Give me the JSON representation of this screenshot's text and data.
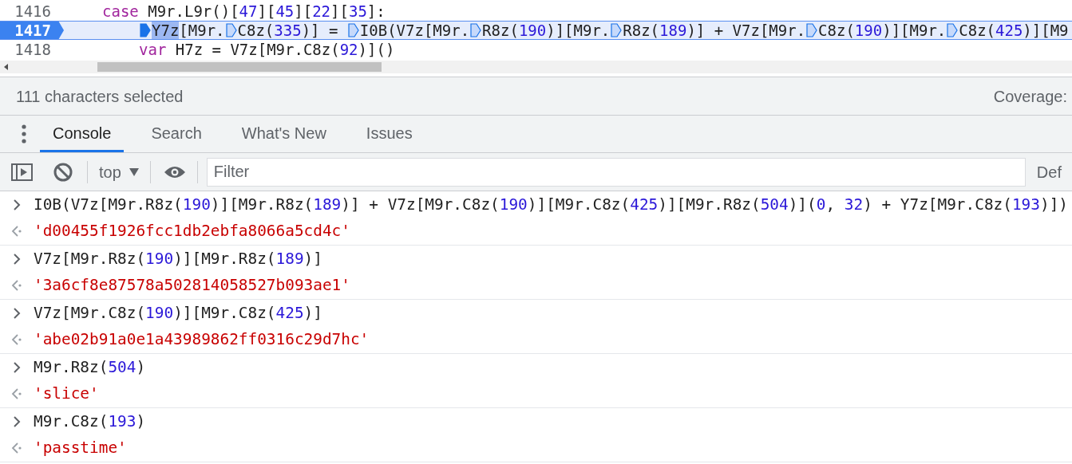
{
  "editor": {
    "lines": [
      {
        "number": "1416",
        "breakpoint": false,
        "paused": false,
        "tokens": [
          {
            "kind": "keyword",
            "text": "case"
          },
          {
            "kind": "plain",
            "text": " M9r.L9r()["
          },
          {
            "kind": "number",
            "text": "47"
          },
          {
            "kind": "plain",
            "text": "]["
          },
          {
            "kind": "number",
            "text": "45"
          },
          {
            "kind": "plain",
            "text": "]["
          },
          {
            "kind": "number",
            "text": "22"
          },
          {
            "kind": "plain",
            "text": "]["
          },
          {
            "kind": "number",
            "text": "35"
          },
          {
            "kind": "plain",
            "text": "]:"
          }
        ],
        "children": [
          {
            "number": "1417",
            "breakpoint": true,
            "paused": true,
            "tokens": [
              {
                "kind": "breakpoint",
                "active": true
              },
              {
                "kind": "selected",
                "text": "Y7z"
              },
              {
                "kind": "plain",
                "text": "[M9r."
              },
              {
                "kind": "breakpoint",
                "active": false
              },
              {
                "kind": "plain",
                "text": "C8z("
              },
              {
                "kind": "number",
                "text": "335"
              },
              {
                "kind": "plain",
                "text": ")] = "
              },
              {
                "kind": "breakpoint",
                "active": false
              },
              {
                "kind": "plain",
                "text": "I0B(V7z[M9r."
              },
              {
                "kind": "breakpoint",
                "active": false
              },
              {
                "kind": "plain",
                "text": "R8z("
              },
              {
                "kind": "number",
                "text": "190"
              },
              {
                "kind": "plain",
                "text": ")][M9r."
              },
              {
                "kind": "breakpoint",
                "active": false
              },
              {
                "kind": "plain",
                "text": "R8z("
              },
              {
                "kind": "number",
                "text": "189"
              },
              {
                "kind": "plain",
                "text": ")] + V7z[M9r."
              },
              {
                "kind": "breakpoint",
                "active": false
              },
              {
                "kind": "plain",
                "text": "C8z("
              },
              {
                "kind": "number",
                "text": "190"
              },
              {
                "kind": "plain",
                "text": ")][M9r."
              },
              {
                "kind": "breakpoint",
                "active": false
              },
              {
                "kind": "plain",
                "text": "C8z("
              },
              {
                "kind": "number",
                "text": "425"
              },
              {
                "kind": "plain",
                "text": ")][M9"
              }
            ]
          },
          {
            "number": "1418",
            "breakpoint": false,
            "paused": false,
            "tokens": [
              {
                "kind": "keyword",
                "text": "var"
              },
              {
                "kind": "plain",
                "text": " H7z = V7z[M9r.C8z("
              },
              {
                "kind": "number",
                "text": "92"
              },
              {
                "kind": "plain",
                "text": ")]()"
              }
            ]
          }
        ]
      }
    ]
  },
  "status_bar": {
    "selection": "111 characters selected",
    "coverage": "Coverage:"
  },
  "drawer_tabs": [
    {
      "label": "Console",
      "selected": true
    },
    {
      "label": "Search",
      "selected": false
    },
    {
      "label": "What's New",
      "selected": false
    },
    {
      "label": "Issues",
      "selected": false
    }
  ],
  "toolbar": {
    "context": "top",
    "filter": {
      "placeholder": "Filter"
    },
    "levels": "Def"
  },
  "console": [
    {
      "input": [
        {
          "kind": "plain",
          "text": "I0B(V7z[M9r.R8z("
        },
        {
          "kind": "number",
          "text": "190"
        },
        {
          "kind": "plain",
          "text": ")][M9r.R8z("
        },
        {
          "kind": "number",
          "text": "189"
        },
        {
          "kind": "plain",
          "text": ")] + V7z[M9r.C8z("
        },
        {
          "kind": "number",
          "text": "190"
        },
        {
          "kind": "plain",
          "text": ")][M9r.C8z("
        },
        {
          "kind": "number",
          "text": "425"
        },
        {
          "kind": "plain",
          "text": ")][M9r.R8z("
        },
        {
          "kind": "number",
          "text": "504"
        },
        {
          "kind": "plain",
          "text": ")]("
        },
        {
          "kind": "number",
          "text": "0"
        },
        {
          "kind": "plain",
          "text": ", "
        },
        {
          "kind": "number",
          "text": "32"
        },
        {
          "kind": "plain",
          "text": ") + Y7z[M9r.C8z("
        },
        {
          "kind": "number",
          "text": "193"
        },
        {
          "kind": "plain",
          "text": ")])"
        }
      ],
      "output": {
        "kind": "string",
        "text": "'d00455f1926fcc1db2ebfa8066a5cd4c'"
      }
    },
    {
      "input": [
        {
          "kind": "plain",
          "text": "V7z[M9r.R8z("
        },
        {
          "kind": "number",
          "text": "190"
        },
        {
          "kind": "plain",
          "text": ")][M9r.R8z("
        },
        {
          "kind": "number",
          "text": "189"
        },
        {
          "kind": "plain",
          "text": ")]"
        }
      ],
      "output": {
        "kind": "string",
        "text": "'3a6cf8e87578a502814058527b093ae1'"
      }
    },
    {
      "input": [
        {
          "kind": "plain",
          "text": "V7z[M9r.C8z("
        },
        {
          "kind": "number",
          "text": "190"
        },
        {
          "kind": "plain",
          "text": ")][M9r.C8z("
        },
        {
          "kind": "number",
          "text": "425"
        },
        {
          "kind": "plain",
          "text": ")]"
        }
      ],
      "output": {
        "kind": "string",
        "text": "'abe02b91a0e1a43989862ff0316c29d7hc'"
      }
    },
    {
      "input": [
        {
          "kind": "plain",
          "text": "M9r.R8z("
        },
        {
          "kind": "number",
          "text": "504"
        },
        {
          "kind": "plain",
          "text": ")"
        }
      ],
      "output": {
        "kind": "string",
        "text": "'slice'"
      }
    },
    {
      "input": [
        {
          "kind": "plain",
          "text": "M9r.C8z("
        },
        {
          "kind": "number",
          "text": "193"
        },
        {
          "kind": "plain",
          "text": ")"
        }
      ],
      "output": {
        "kind": "string",
        "text": "'passtime'"
      }
    }
  ]
}
